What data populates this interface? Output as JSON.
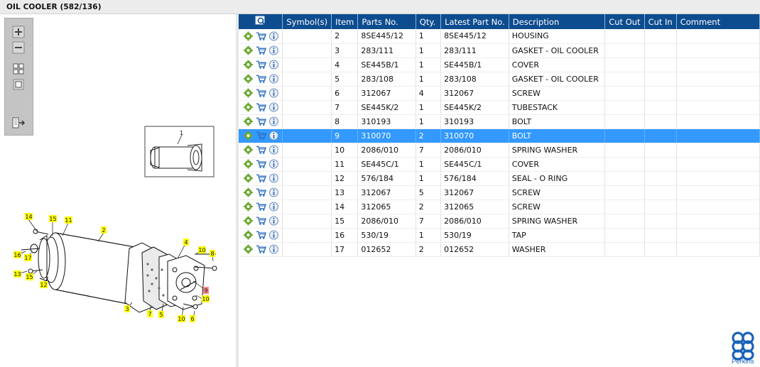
{
  "window": {
    "title": "OIL COOLER (582/136)"
  },
  "toolbar": {
    "buttons": [
      "zoom-in",
      "zoom-out",
      "fit-all",
      "fit-window",
      "export"
    ]
  },
  "table": {
    "columns": [
      "",
      "Symbol(s)",
      "Item",
      "Parts No.",
      "Qty.",
      "Latest Part No.",
      "Description",
      "Cut Out",
      "Cut In",
      "Comment"
    ],
    "rows": [
      {
        "item": "2",
        "parts_no": "8SE445/12",
        "qty": "1",
        "latest": "8SE445/12",
        "desc": "HOUSING"
      },
      {
        "item": "3",
        "parts_no": "283/111",
        "qty": "1",
        "latest": "283/111",
        "desc": "GASKET - OIL COOLER"
      },
      {
        "item": "4",
        "parts_no": "SE445B/1",
        "qty": "1",
        "latest": "SE445B/1",
        "desc": "COVER"
      },
      {
        "item": "5",
        "parts_no": "283/108",
        "qty": "1",
        "latest": "283/108",
        "desc": "GASKET - OIL COOLER"
      },
      {
        "item": "6",
        "parts_no": "312067",
        "qty": "4",
        "latest": "312067",
        "desc": "SCREW"
      },
      {
        "item": "7",
        "parts_no": "SE445K/2",
        "qty": "1",
        "latest": "SE445K/2",
        "desc": "TUBESTACK"
      },
      {
        "item": "8",
        "parts_no": "310193",
        "qty": "1",
        "latest": "310193",
        "desc": "BOLT"
      },
      {
        "item": "9",
        "parts_no": "310070",
        "qty": "2",
        "latest": "310070",
        "desc": "BOLT"
      },
      {
        "item": "10",
        "parts_no": "2086/010",
        "qty": "7",
        "latest": "2086/010",
        "desc": "SPRING WASHER"
      },
      {
        "item": "11",
        "parts_no": "SE445C/1",
        "qty": "1",
        "latest": "SE445C/1",
        "desc": "COVER"
      },
      {
        "item": "12",
        "parts_no": "576/184",
        "qty": "1",
        "latest": "576/184",
        "desc": "SEAL - O RING"
      },
      {
        "item": "13",
        "parts_no": "312067",
        "qty": "5",
        "latest": "312067",
        "desc": "SCREW"
      },
      {
        "item": "14",
        "parts_no": "312065",
        "qty": "2",
        "latest": "312065",
        "desc": "SCREW"
      },
      {
        "item": "15",
        "parts_no": "2086/010",
        "qty": "7",
        "latest": "2086/010",
        "desc": "SPRING WASHER"
      },
      {
        "item": "16",
        "parts_no": "530/19",
        "qty": "1",
        "latest": "530/19",
        "desc": "TAP"
      },
      {
        "item": "17",
        "parts_no": "012652",
        "qty": "2",
        "latest": "012652",
        "desc": "WASHER"
      }
    ],
    "selected_item": "9"
  },
  "diagram": {
    "inset_label": "1",
    "callouts": [
      "14",
      "15",
      "11",
      "2",
      "16",
      "17",
      "13",
      "15",
      "12",
      "3",
      "7",
      "5",
      "4",
      "10",
      "8",
      "9",
      "10",
      "10",
      "6"
    ],
    "highlighted_callout": "9"
  },
  "brand": {
    "name": "Perkins",
    "color": "#1a63b6"
  },
  "colors": {
    "header": "#0d4c8f",
    "selection": "#3399ff",
    "callout": "#ffff00",
    "callout_selected": "#ff8a8a"
  }
}
